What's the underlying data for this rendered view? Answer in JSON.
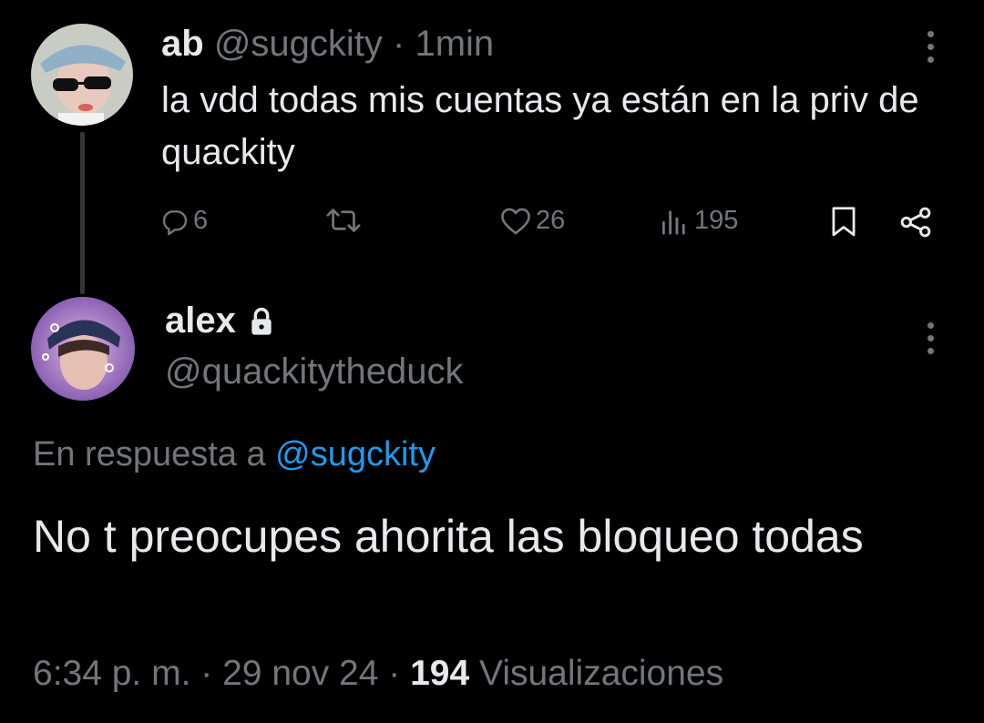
{
  "tweet": {
    "display_name": "ab",
    "handle": "@sugckity",
    "separator": " · ",
    "time": "1min",
    "text": "la vdd todas mis cuentas ya están en la priv de quackity",
    "actions": {
      "replies": "6",
      "retweets": "",
      "likes": "26",
      "views": "195"
    }
  },
  "reply": {
    "display_name": "alex",
    "handle": "@quackitytheduck",
    "in_reply_prefix": "En respuesta a ",
    "in_reply_mention": "@sugckity",
    "text": "No t preocupes ahorita las bloqueo todas",
    "footer": {
      "time": "6:34 p. m.",
      "sep1": " · ",
      "date": "29 nov 24",
      "sep2": " · ",
      "views_count": "194",
      "views_label": " Visualizaciones"
    }
  },
  "colors": {
    "background": "#000000",
    "text": "#e7e9ea",
    "muted": "#71767b",
    "link": "#1d9bf0"
  },
  "icons": [
    "reply-icon",
    "retweet-icon",
    "like-icon",
    "views-icon",
    "bookmark-icon",
    "share-icon",
    "more-icon",
    "lock-icon"
  ]
}
